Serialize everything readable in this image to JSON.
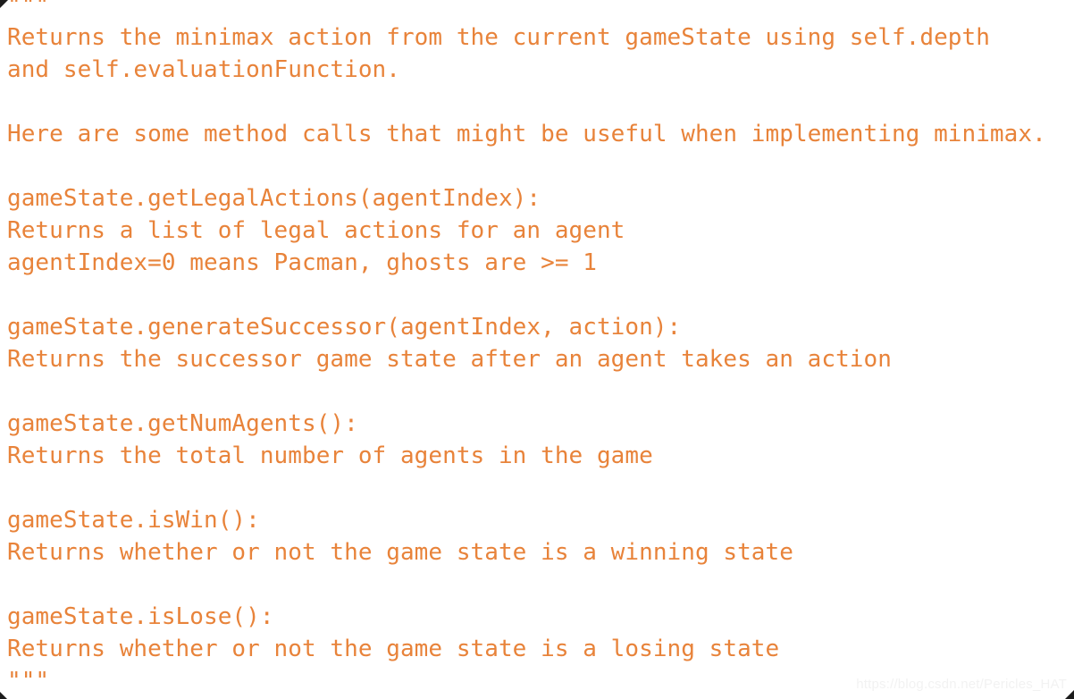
{
  "document": {
    "type": "python-docstring",
    "colors": {
      "text": "#e8833a",
      "background": "#ffffff",
      "watermark": "#f2f2f2",
      "corner_marker": "#1c1c1c"
    },
    "lines": [
      {
        "id": "l0",
        "text": "\"\"\""
      },
      {
        "id": "l1",
        "text": "Returns the minimax action from the current gameState using self.depth"
      },
      {
        "id": "l2",
        "text": "and self.evaluationFunction."
      },
      {
        "id": "l3",
        "text": ""
      },
      {
        "id": "l4",
        "text": "Here are some method calls that might be useful when implementing minimax."
      },
      {
        "id": "l5",
        "text": ""
      },
      {
        "id": "l6",
        "text": "gameState.getLegalActions(agentIndex):"
      },
      {
        "id": "l7",
        "text": "Returns a list of legal actions for an agent"
      },
      {
        "id": "l8",
        "text": "agentIndex=0 means Pacman, ghosts are >= 1"
      },
      {
        "id": "l9",
        "text": ""
      },
      {
        "id": "l10",
        "text": "gameState.generateSuccessor(agentIndex, action):"
      },
      {
        "id": "l11",
        "text": "Returns the successor game state after an agent takes an action"
      },
      {
        "id": "l12",
        "text": ""
      },
      {
        "id": "l13",
        "text": "gameState.getNumAgents():"
      },
      {
        "id": "l14",
        "text": "Returns the total number of agents in the game"
      },
      {
        "id": "l15",
        "text": ""
      },
      {
        "id": "l16",
        "text": "gameState.isWin():"
      },
      {
        "id": "l17",
        "text": "Returns whether or not the game state is a winning state"
      },
      {
        "id": "l18",
        "text": ""
      },
      {
        "id": "l19",
        "text": "gameState.isLose():"
      },
      {
        "id": "l20",
        "text": "Returns whether or not the game state is a losing state"
      },
      {
        "id": "l21",
        "text": "\"\"\""
      }
    ]
  },
  "watermark": {
    "text": "https://blog.csdn.net/Pericles_HAT"
  }
}
